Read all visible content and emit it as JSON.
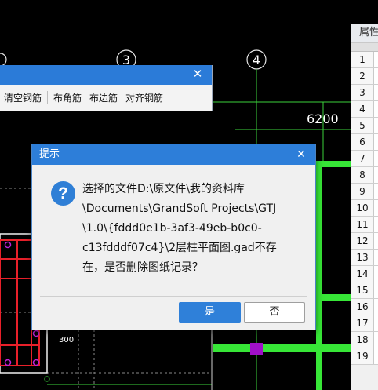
{
  "cad": {
    "axis_labels": [
      "3",
      "4"
    ],
    "dimension": "6200",
    "small_dimension": "300"
  },
  "property_panel": {
    "title": "属性",
    "rows": [
      "1",
      "2",
      "3",
      "4",
      "5",
      "6",
      "7",
      "8",
      "9",
      "10",
      "11",
      "12",
      "13",
      "14",
      "15",
      "16",
      "17",
      "18",
      "19"
    ]
  },
  "toolbar": {
    "buttons": [
      "清空钢筋",
      "布角筋",
      "布边筋",
      "对齐钢筋"
    ]
  },
  "dialog": {
    "title": "提示",
    "icon": "question-icon",
    "message_lines": [
      "选择的文件D:\\原文件\\我的资料库",
      "\\Documents\\GrandSoft Projects\\GTJ",
      "\\1.0\\{fddd0e1b-3af3-49eb-b0c0-",
      "c13fdddf07c4}\\2层柱平面图.gad不存",
      "在，是否删除图纸记录？"
    ],
    "yes_label": "是",
    "no_label": "否"
  },
  "colors": {
    "accent": "#2d7ed9",
    "cad_green": "#32e832",
    "cad_red": "#e8202a",
    "cad_purple": "#c020d8"
  }
}
